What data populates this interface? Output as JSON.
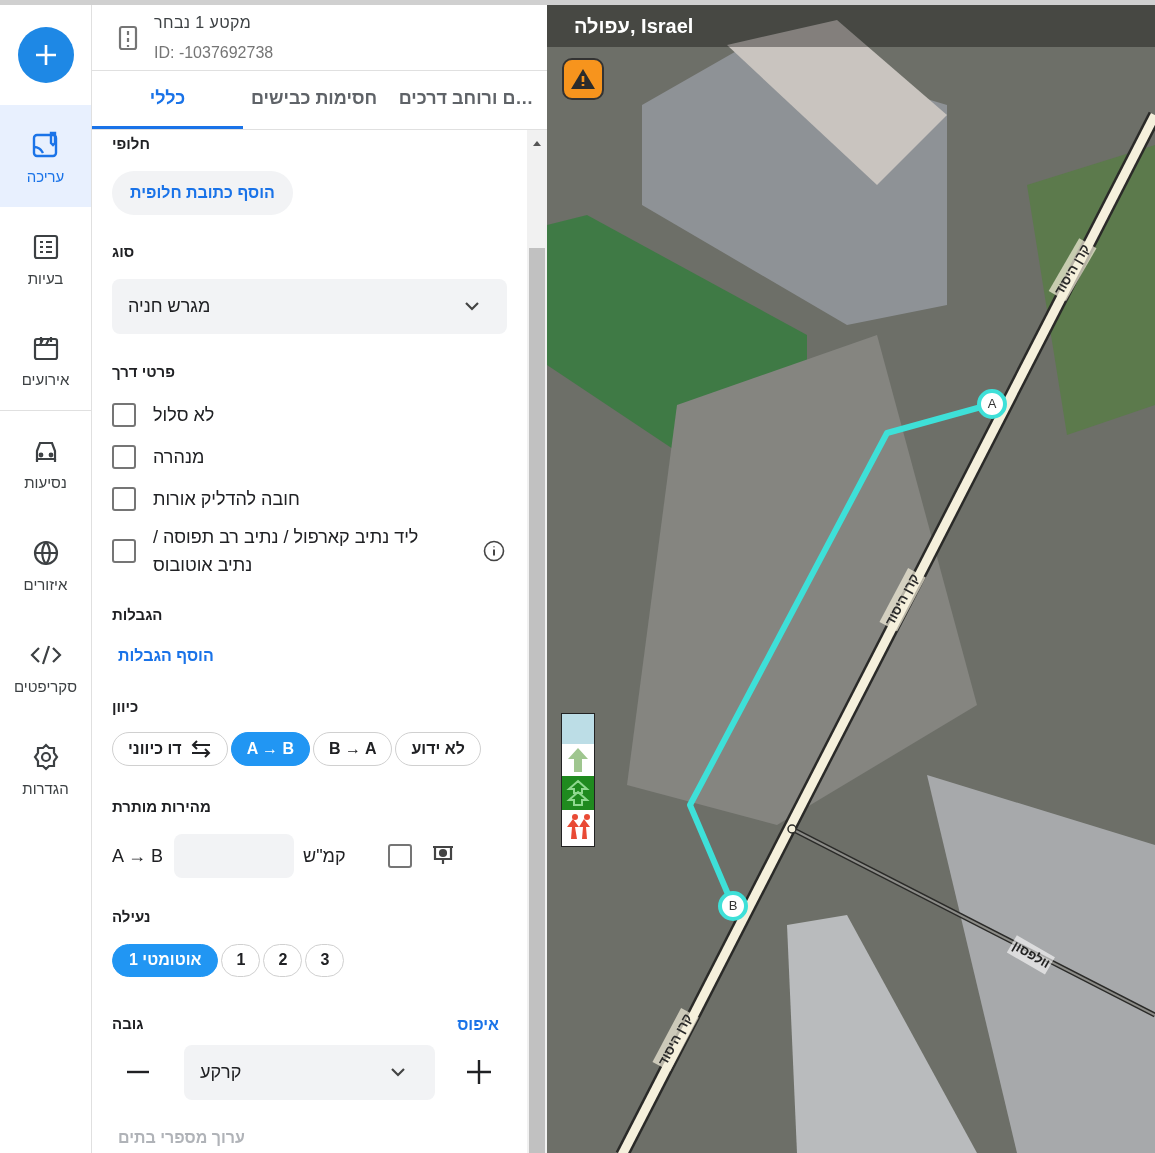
{
  "sidebar": {
    "items": [
      {
        "label": "עריכה",
        "selected": true
      },
      {
        "label": "בעיות",
        "selected": false
      },
      {
        "label": "אירועים",
        "selected": false
      },
      {
        "label": "נסיעות",
        "selected": false
      },
      {
        "label": "איזורים",
        "selected": false
      },
      {
        "label": "סקריפטים",
        "selected": false
      },
      {
        "label": "הגדרות",
        "selected": false
      }
    ]
  },
  "segment_header": {
    "title": "מקטע 1 נבחר",
    "id": "ID: -1037692738"
  },
  "tabs": [
    {
      "label": "…ם ורוחב דרכים",
      "selected": false
    },
    {
      "label": "חסימות כבישים",
      "selected": false
    },
    {
      "label": "כללי",
      "selected": true
    }
  ],
  "alt_name": {
    "label": "חלופי",
    "button": "הוסף כתובת חלופית"
  },
  "type": {
    "label": "סוג",
    "value": "מגרש חניה"
  },
  "road_details": {
    "label": "פרטי דרך",
    "options": [
      {
        "label": "לא סלול",
        "checked": false,
        "info": false
      },
      {
        "label": "מנהרה",
        "checked": false,
        "info": false
      },
      {
        "label": "חובה להדליק אורות",
        "checked": false,
        "info": false
      },
      {
        "label": "ליד נתיב קארפול / נתיב רב תפוסה / נתיב אוטובוס",
        "checked": false,
        "info": true
      }
    ]
  },
  "restrictions": {
    "label": "הגבלות",
    "link": "הוסף הגבלות"
  },
  "direction": {
    "label": "כיוון",
    "options": [
      {
        "label": "לא ידוע",
        "kind": "text",
        "selected": false
      },
      {
        "label": "B → A",
        "kind": "text",
        "selected": false
      },
      {
        "label": "A → B",
        "kind": "text",
        "selected": true
      },
      {
        "label": "דו כיווני",
        "kind": "two_way",
        "selected": false
      }
    ]
  },
  "speed": {
    "label": "מהירות מותרת",
    "direction": "A → B",
    "unit": "קמ\"ש",
    "camera_checked": false
  },
  "lanes": {
    "label": "נעילה",
    "options": [
      {
        "label": "3",
        "kind": "number",
        "selected": false
      },
      {
        "label": "2",
        "kind": "number",
        "selected": false
      },
      {
        "label": "1",
        "kind": "number",
        "selected": false
      },
      {
        "label": "אוטומטי 1",
        "kind": "auto",
        "selected": true
      }
    ]
  },
  "elevation": {
    "label": "גובה",
    "reset": "איפוס",
    "value": "קרקע"
  },
  "house_numbers": {
    "label": "ערוך מספרי בתים",
    "disabled": true
  },
  "map": {
    "place": "עפולה, Israel",
    "route": {
      "start": "A",
      "end": "B"
    },
    "street_labels": [
      {
        "label": "קרן היסוד",
        "kind": "main"
      },
      {
        "label": "קרן היסוד",
        "kind": "main"
      },
      {
        "label": "קרן היסוד",
        "kind": "main"
      },
      {
        "label": "וולפסון",
        "kind": "side"
      }
    ]
  }
}
